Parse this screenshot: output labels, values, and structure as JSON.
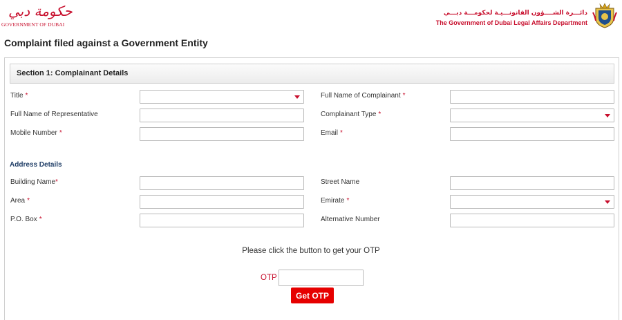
{
  "header": {
    "left_logo": {
      "arabic": "حكومة دبي",
      "english": "GOVERNMENT OF DUBAI"
    },
    "right_logo": {
      "arabic": "دائـــرة الشــــؤون القانونـــيـة لحكومـــة دبـــي",
      "english": "The Government of Dubai Legal Affairs Department"
    }
  },
  "page_title": "Complaint filed against a Government Entity",
  "section1": {
    "title": "Section 1: Complainant Details",
    "title_label": "Title",
    "full_name_label": "Full Name of Complainant",
    "rep_name_label": "Full Name of Representative",
    "complainant_type_label": "Complainant Type",
    "mobile_label": "Mobile Number",
    "email_label": "Email",
    "required_mark": "*"
  },
  "address": {
    "heading": "Address Details",
    "building_label": "Building Name",
    "street_label": "Street Name",
    "area_label": "Area",
    "emirate_label": "Emirate",
    "pobox_label": "P.O. Box",
    "alt_number_label": "Alternative Number"
  },
  "otp": {
    "instruction": "Please click the button to get your OTP",
    "label": "OTP",
    "value": "",
    "button_label": "Get OTP"
  },
  "colors": {
    "accent_red": "#c8102e",
    "button_red": "#e60000",
    "heading_blue": "#1f3d66"
  },
  "icons": {
    "emblem": "dubai-emblem-icon",
    "dropdown": "chevron-down-icon"
  }
}
